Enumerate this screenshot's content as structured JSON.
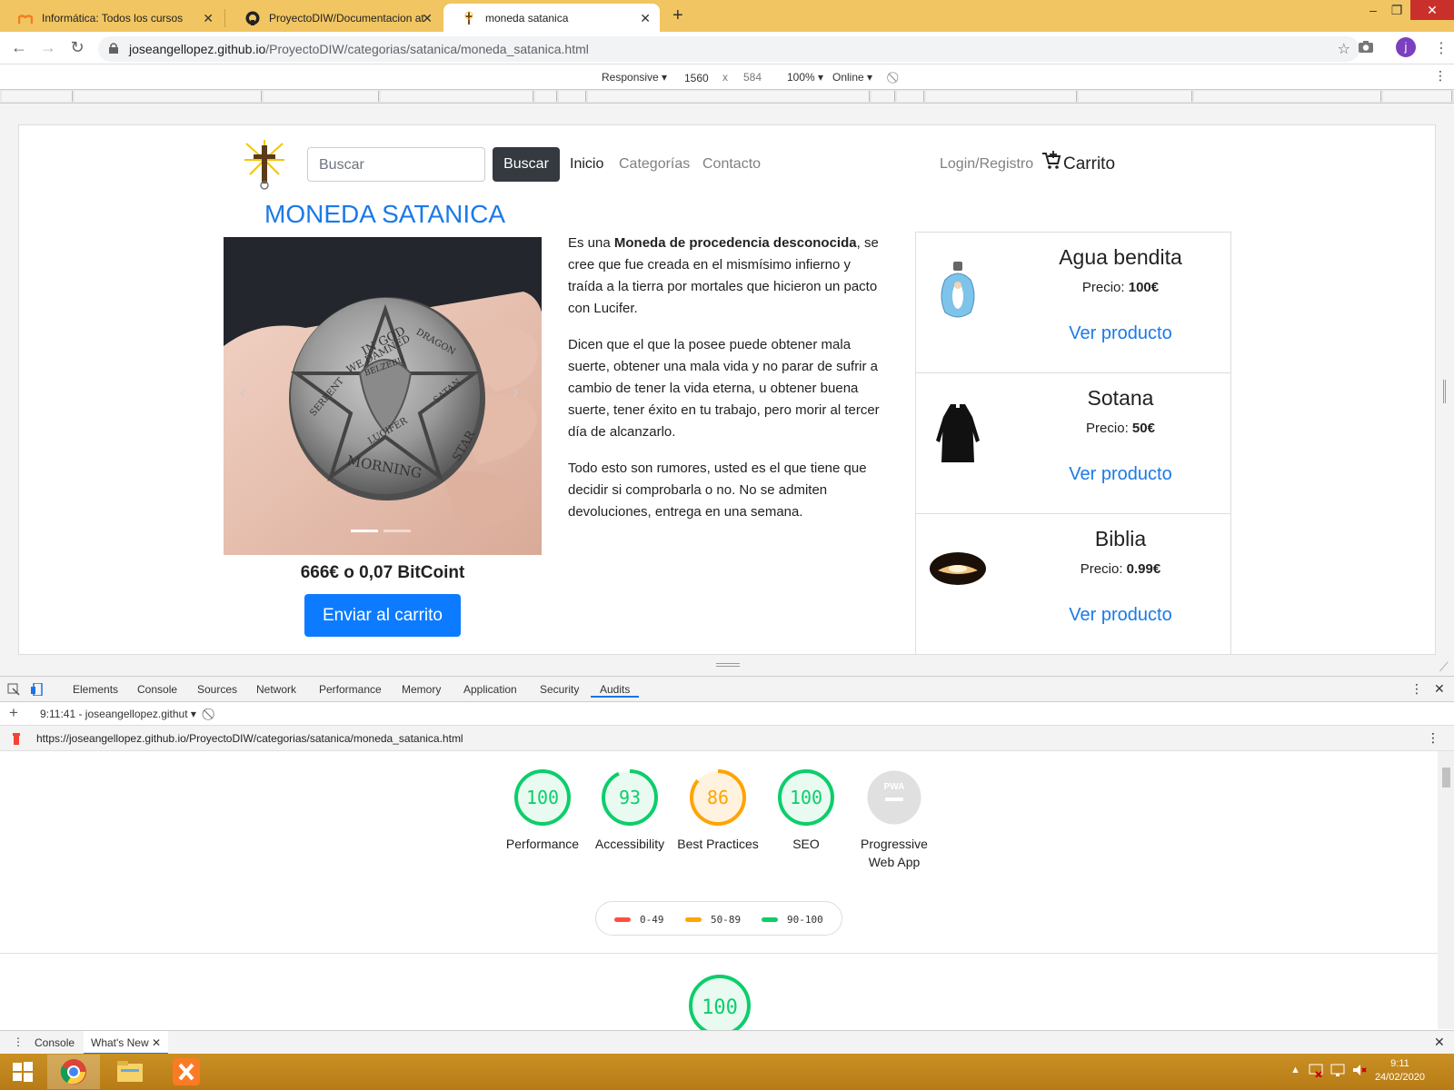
{
  "browser": {
    "tabs": [
      {
        "title": "Informática: Todos los cursos"
      },
      {
        "title": "ProyectoDIW/Documentacion at"
      },
      {
        "title": "moneda satanica"
      }
    ],
    "url_host": "joseangellopez.github.io",
    "url_path": "/ProyectoDIW/categorias/satanica/moneda_satanica.html",
    "profile_initial": "j"
  },
  "device_toolbar": {
    "mode": "Responsive",
    "width": "1560",
    "x": "x",
    "height": "584",
    "zoom": "100%",
    "network": "Online"
  },
  "site": {
    "search_placeholder": "Buscar",
    "search_button": "Buscar",
    "nav": {
      "inicio": "Inicio",
      "categorias": "Categorías",
      "contacto": "Contacto",
      "login": "Login/Registro",
      "carrito": "Carrito"
    },
    "product": {
      "title": "MONEDA SATANICA",
      "price": "666€ o 0,07 BitCoint",
      "cart_button": "Enviar al carrito",
      "desc1_a": "Es una ",
      "desc1_b": "Moneda de procedencia desconocida",
      "desc1_c": ", se cree que fue creada en el mismísimo infierno y traída a la tierra por mortales que hicieron un pacto con Lucifer.",
      "desc2": "Dicen que el que la posee puede obtener mala suerte, obtener una mala vida y no parar de sufrir a cambio de tener la vida eterna, u obtener buena suerte, tener éxito en tu trabajo, pero morir al tercer día de alcanzarlo.",
      "desc3": "Todo esto son rumores, usted es el que tiene que decidir si comprobarla o no. No se admiten devoluciones, entrega en una semana.",
      "coin_text": [
        "IN GOD",
        "WE DAMNED",
        "BELZEBU",
        "DRAGON",
        "SATAN",
        "SERPENT",
        "LUCIFER",
        "MORNING",
        "STAR"
      ]
    },
    "related": [
      {
        "name": "Agua bendita",
        "price_label": "Precio: ",
        "price": "100€",
        "link": "Ver producto"
      },
      {
        "name": "Sotana",
        "price_label": "Precio: ",
        "price": "50€",
        "link": "Ver producto"
      },
      {
        "name": "Biblia",
        "price_label": "Precio: ",
        "price": "0.99€",
        "link": "Ver producto"
      }
    ]
  },
  "devtools": {
    "tabs": [
      "Elements",
      "Console",
      "Sources",
      "Network",
      "Performance",
      "Memory",
      "Application",
      "Security",
      "Audits"
    ],
    "active_tab": "Audits",
    "report_selector": "9:11:41 - joseangellopez.githut",
    "report_url": "https://joseangellopez.github.io/ProyectoDIW/categorias/satanica/moneda_satanica.html",
    "scores": [
      {
        "label": "Performance",
        "score": "100",
        "value": 100,
        "color": "#0cce6b"
      },
      {
        "label": "Accessibility",
        "score": "93",
        "value": 93,
        "color": "#0cce6b"
      },
      {
        "label": "Best Practices",
        "score": "86",
        "value": 86,
        "color": "#ffa400"
      },
      {
        "label": "SEO",
        "score": "100",
        "value": 100,
        "color": "#0cce6b"
      },
      {
        "label": "Progressive Web App",
        "score": "PWA",
        "value": 0,
        "color": "#cccccc"
      }
    ],
    "legend": [
      {
        "range": "0-49",
        "color": "#ff4e42"
      },
      {
        "range": "50-89",
        "color": "#ffa400"
      },
      {
        "range": "90-100",
        "color": "#0cce6b"
      }
    ],
    "bottom_score": "100",
    "drawer_tabs": [
      "Console",
      "What's New"
    ]
  },
  "taskbar": {
    "time": "9:11",
    "date": "24/02/2020"
  }
}
